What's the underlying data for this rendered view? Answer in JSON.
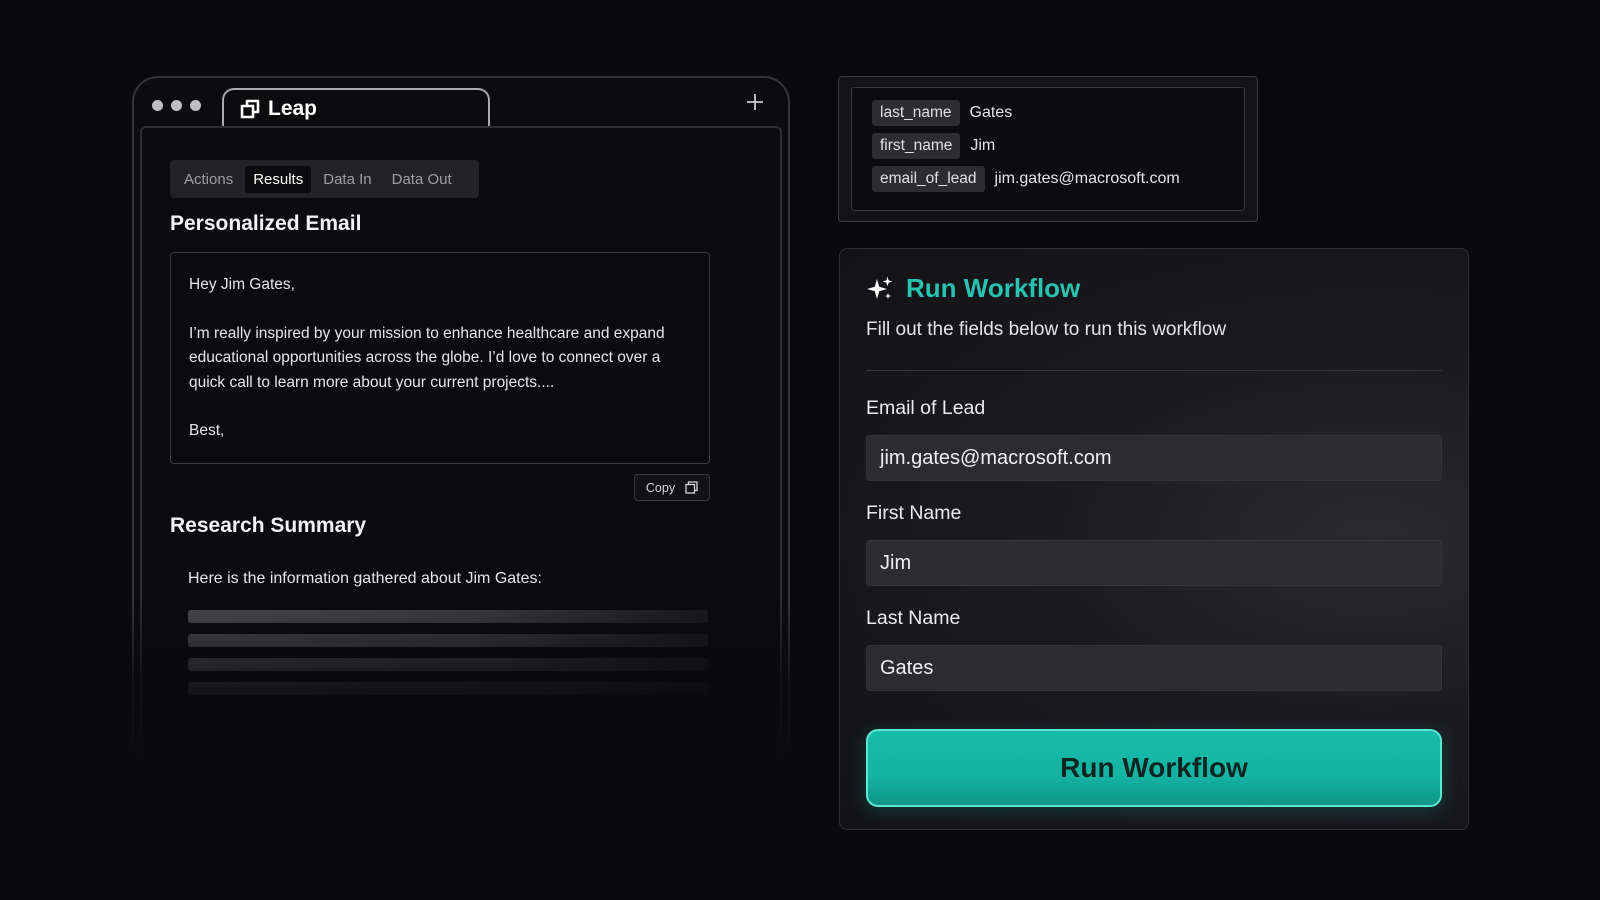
{
  "browser": {
    "tab_title": "Leap",
    "tabs": [
      "Actions",
      "Results",
      "Data In",
      "Data Out"
    ],
    "active_tab": "Results",
    "email_section": {
      "heading": "Personalized Email",
      "greeting": "Hey Jim Gates,",
      "body": "I’m really inspired by your mission to enhance healthcare and expand educational opportunities across the globe. I’d love to connect over a quick call to learn more about your current projects....",
      "signoff": "Best,",
      "copy_label": "Copy"
    },
    "research_section": {
      "heading": "Research Summary",
      "intro": "Here is the information gathered about Jim Gates:"
    }
  },
  "variables": [
    {
      "key": "last_name",
      "value": "Gates"
    },
    {
      "key": "first_name",
      "value": "Jim"
    },
    {
      "key": "email_of_lead",
      "value": "jim.gates@macrosoft.com"
    }
  ],
  "workflow": {
    "title": "Run Workflow",
    "subtitle": "Fill out the fields below to run this workflow",
    "fields": [
      {
        "label": "Email of Lead",
        "value": "jim.gates@macrosoft.com"
      },
      {
        "label": "First Name",
        "value": "Jim"
      },
      {
        "label": "Last Name",
        "value": "Gates"
      }
    ],
    "button_label": "Run Workflow"
  },
  "colors": {
    "accent": "#27c2b0",
    "button": "#17bcaa",
    "background": "#0a0a0c"
  },
  "icons": [
    "leap-logo-icon",
    "plus-icon",
    "copy-icon",
    "sparkle-icon"
  ]
}
